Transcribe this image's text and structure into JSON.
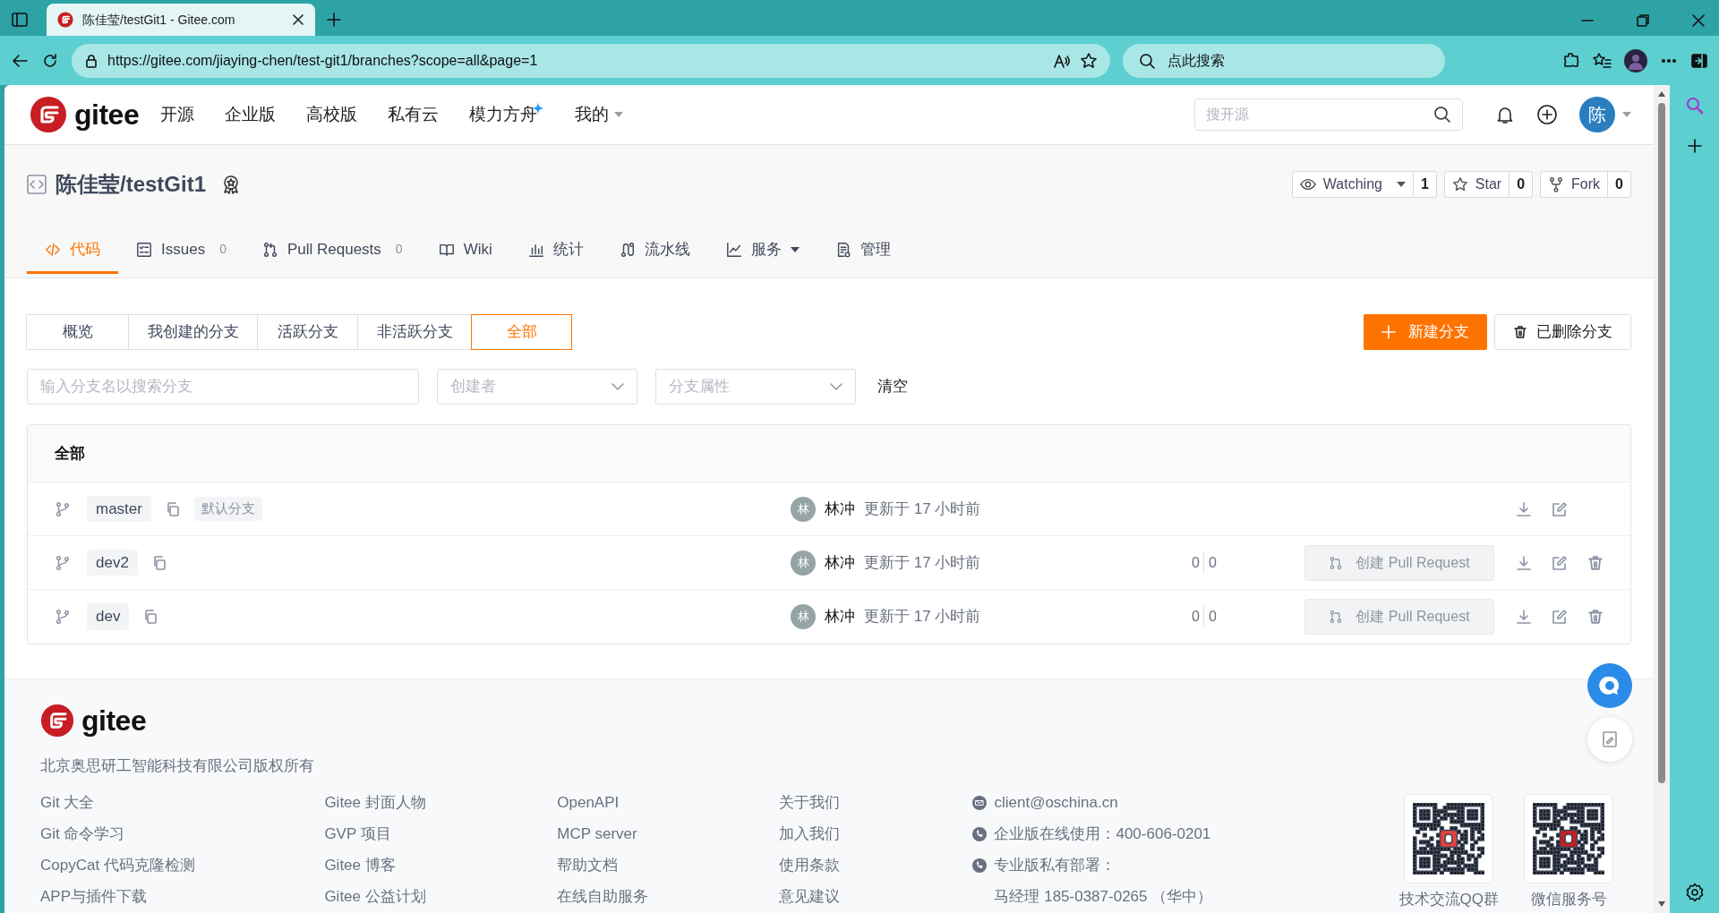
{
  "browser": {
    "tab_title": "陈佳莹/testGit1 - Gitee.com",
    "url": "https://gitee.com/jiaying-chen/test-git1/branches?scope=all&page=1",
    "search_placeholder": "点此搜索"
  },
  "navbar": {
    "logo": "gitee",
    "items": [
      {
        "label": "开源",
        "dropdown": false,
        "sparkle": false
      },
      {
        "label": "企业版",
        "dropdown": false,
        "sparkle": false
      },
      {
        "label": "高校版",
        "dropdown": false,
        "sparkle": false
      },
      {
        "label": "私有云",
        "dropdown": false,
        "sparkle": false
      },
      {
        "label": "模力方舟",
        "dropdown": false,
        "sparkle": true
      },
      {
        "label": "我的",
        "dropdown": true,
        "sparkle": false
      }
    ],
    "search_placeholder": "搜开源",
    "avatar": "陈"
  },
  "repo": {
    "title": "陈佳莹/testGit1",
    "actions": [
      {
        "label": "Watching",
        "dropdown": true,
        "count": "1"
      },
      {
        "label": "Star",
        "dropdown": false,
        "count": "0"
      },
      {
        "label": "Fork",
        "dropdown": false,
        "count": "0"
      }
    ]
  },
  "tabs": [
    {
      "label": "代码",
      "dropdown": false,
      "selected": true
    },
    {
      "label": "Issues",
      "count": "0",
      "dropdown": false,
      "selected": false
    },
    {
      "label": "Pull Requests",
      "count": "0",
      "dropdown": false,
      "selected": false
    },
    {
      "label": "Wiki",
      "dropdown": false,
      "selected": false
    },
    {
      "label": "统计",
      "dropdown": false,
      "selected": false
    },
    {
      "label": "流水线",
      "dropdown": false,
      "selected": false
    },
    {
      "label": "服务",
      "dropdown": true,
      "selected": false
    },
    {
      "label": "管理",
      "dropdown": false,
      "selected": false
    }
  ],
  "branch_filters": [
    {
      "label": "概览",
      "selected": false
    },
    {
      "label": "我创建的分支",
      "selected": false
    },
    {
      "label": "活跃分支",
      "selected": false
    },
    {
      "label": "非活跃分支",
      "selected": false
    },
    {
      "label": "全部",
      "selected": true
    }
  ],
  "new_branch_button": "新建分支",
  "deleted_branches_button": "已删除分支",
  "filters": {
    "search_placeholder": "输入分支名以搜索分支",
    "selects": [
      {
        "placeholder": "创建者"
      },
      {
        "placeholder": "分支属性"
      }
    ],
    "clear": "清空"
  },
  "branch_table": {
    "title": "全部",
    "rows": [
      {
        "name": "master",
        "default_label": "默认分支",
        "avatar": "林",
        "author": "林冲",
        "updated": "更新于 17 小时前",
        "deletable": false
      },
      {
        "name": "dev2",
        "avatar": "林",
        "author": "林冲",
        "updated": "更新于 17 小时前",
        "behind": "0",
        "ahead": "0",
        "pr_button": {
          "label": "创建 Pull Request",
          "disabled": true
        },
        "deletable": true
      },
      {
        "name": "dev",
        "avatar": "林",
        "author": "林冲",
        "updated": "更新于 17 小时前",
        "behind": "0",
        "ahead": "0",
        "pr_button": {
          "label": "创建 Pull Request",
          "disabled": true
        },
        "deletable": true
      }
    ]
  },
  "footer": {
    "logo": "gitee",
    "copyright": "北京奥思研工智能科技有限公司版权所有",
    "link_columns": [
      [
        "Git 大全",
        "Git 命令学习",
        "CopyCat 代码克隆检测",
        "APP与插件下载"
      ],
      [
        "Gitee 封面人物",
        "GVP 项目",
        "Gitee 博客",
        "Gitee 公益计划"
      ],
      [
        "OpenAPI",
        "MCP server",
        "帮助文档",
        "在线自助服务"
      ],
      [
        "关于我们",
        "加入我们",
        "使用条款",
        "意见建议"
      ]
    ],
    "contacts": [
      {
        "kind": "mail",
        "text": "client@oschina.cn"
      },
      {
        "kind": "phone",
        "text": "企业版在线使用：400-606-0201"
      },
      {
        "kind": "phone",
        "text": "专业版私有部署："
      },
      {
        "kind": "plain",
        "text": "马经理 185-0387-0265 （华中）"
      }
    ],
    "qr_codes": [
      {
        "label": "技术交流QQ群"
      },
      {
        "label": "微信服务号"
      }
    ]
  }
}
